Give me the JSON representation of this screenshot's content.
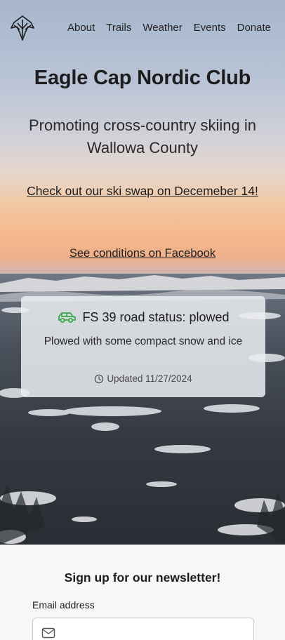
{
  "nav": {
    "logo_name": "eagle-logo",
    "links": [
      "About",
      "Trails",
      "Weather",
      "Events",
      "Donate"
    ]
  },
  "hero": {
    "title": "Eagle Cap Nordic Club",
    "subtitle": "Promoting cross-country skiing in Wallowa County",
    "swap_link": "Check out our ski swap on Decemeber 14!",
    "facebook_link": "See conditions on Facebook"
  },
  "road_status": {
    "icon": "car-icon",
    "icon_color": "#3aa84a",
    "title": "FS 39 road status: plowed",
    "description": "Plowed with some compact snow and ice",
    "updated": "Updated 11/27/2024"
  },
  "newsletter": {
    "title": "Sign up for our newsletter!",
    "email_label": "Email address",
    "email_value": "",
    "email_placeholder": ""
  }
}
